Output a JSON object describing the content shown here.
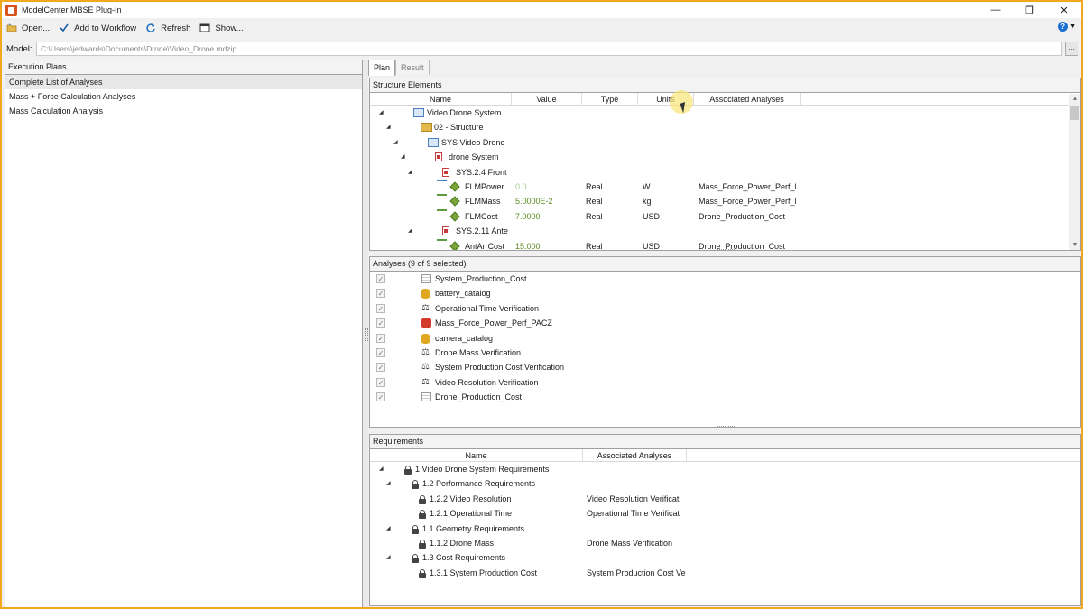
{
  "window": {
    "title": "ModelCenter MBSE Plug-In",
    "controls": [
      "—",
      "❐",
      "✕"
    ]
  },
  "toolbar": {
    "open": "Open...",
    "add_to_workflow": "Add to Workflow",
    "refresh": "Refresh",
    "show": "Show...",
    "help": "?"
  },
  "model": {
    "label": "Model:",
    "path": "C:\\Users\\jedwards\\Documents\\Drone\\Video_Drone.mdzip",
    "browse": "..."
  },
  "execution_plans": {
    "header": "Execution Plans",
    "items": [
      {
        "label": "Complete List of Analyses",
        "selected": true
      },
      {
        "label": "Mass + Force Calculation Analyses",
        "selected": false
      },
      {
        "label": "Mass Calculation Analysis",
        "selected": false
      }
    ]
  },
  "tabs": [
    {
      "label": "Plan",
      "active": true
    },
    {
      "label": "Result",
      "active": false
    }
  ],
  "structure": {
    "header": "Structure Elements",
    "columns": [
      "Name",
      "Value",
      "Type",
      "Units",
      "Associated Analyses"
    ],
    "rows": [
      {
        "level": 0,
        "icon": "system-block-icon",
        "expand": "◢",
        "name": "Video Drone System",
        "value": "",
        "type": "",
        "units": "",
        "analyses": ""
      },
      {
        "level": 1,
        "icon": "package-icon",
        "expand": "◢",
        "name": "02 - Structure",
        "value": "",
        "type": "",
        "units": "",
        "analyses": ""
      },
      {
        "level": 2,
        "icon": "system-block-icon",
        "expand": "◢",
        "name": "SYS Video Drone",
        "value": "",
        "type": "",
        "units": "",
        "analyses": ""
      },
      {
        "level": 3,
        "icon": "part-block-icon",
        "expand": "◢",
        "name": "drone System",
        "value": "",
        "type": "",
        "units": "",
        "analyses": ""
      },
      {
        "level": 4,
        "icon": "part-block-icon",
        "expand": "◢",
        "name": "SYS.2.4 Front",
        "value": "",
        "type": "",
        "units": "",
        "analyses": ""
      },
      {
        "level": 5,
        "icon": "value-property-icon",
        "expand": "",
        "name": "FLMPower",
        "value": "0.0",
        "value_dim": true,
        "type": "Real",
        "units": "W",
        "analyses": "Mass_Force_Power_Perf_Pi"
      },
      {
        "level": 5,
        "icon": "value-property-icon",
        "expand": "",
        "name": "FLMMass",
        "value": "5.0000E-2",
        "value_dim": false,
        "type": "Real",
        "units": "kg",
        "analyses": "Mass_Force_Power_Perf_Pi"
      },
      {
        "level": 5,
        "icon": "value-property-icon",
        "expand": "",
        "name": "FLMCost",
        "value": "7.0000",
        "value_dim": false,
        "type": "Real",
        "units": "USD",
        "analyses": "Drone_Production_Cost"
      },
      {
        "level": 4,
        "icon": "part-block-icon",
        "expand": "◢",
        "name": "SYS.2.11 Ante",
        "value": "",
        "type": "",
        "units": "",
        "analyses": ""
      },
      {
        "level": 5,
        "icon": "value-property-icon",
        "expand": "",
        "name": "AntArrCost",
        "value": "15.000",
        "value_dim": false,
        "type": "Real",
        "units": "USD",
        "analyses": "Drone_Production_Cost"
      }
    ]
  },
  "analyses": {
    "header": "Analyses (9 of 9 selected)",
    "items": [
      {
        "label": "System_Production_Cost",
        "icon": "spreadsheet-icon",
        "checked": true
      },
      {
        "label": "battery_catalog",
        "icon": "database-icon",
        "checked": true
      },
      {
        "label": "Operational Time Verification",
        "icon": "scale-icon",
        "checked": true
      },
      {
        "label": "Mass_Force_Power_Perf_PACZ",
        "icon": "workflow-icon",
        "checked": true
      },
      {
        "label": "camera_catalog",
        "icon": "database-icon",
        "checked": true
      },
      {
        "label": "Drone Mass Verification",
        "icon": "scale-icon",
        "checked": true
      },
      {
        "label": "System Production Cost Verification",
        "icon": "scale-icon",
        "checked": true
      },
      {
        "label": "Video Resolution Verification",
        "icon": "scale-icon",
        "checked": true
      },
      {
        "label": "Drone_Production_Cost",
        "icon": "spreadsheet-icon",
        "checked": true
      }
    ]
  },
  "requirements": {
    "header": "Requirements",
    "columns": [
      "Name",
      "Associated Analyses"
    ],
    "rows": [
      {
        "level": 0,
        "expand": "◢",
        "name": "1 Video Drone System Requirements",
        "analyses": ""
      },
      {
        "level": 1,
        "expand": "◢",
        "name": "1.2 Performance Requirements",
        "analyses": ""
      },
      {
        "level": 2,
        "expand": "",
        "name": "1.2.2 Video Resolution",
        "analyses": "Video Resolution Verificati"
      },
      {
        "level": 2,
        "expand": "",
        "name": "1.2.1 Operational Time",
        "analyses": "Operational Time Verificat"
      },
      {
        "level": 1,
        "expand": "◢",
        "name": "1.1 Geometry Requirements",
        "analyses": ""
      },
      {
        "level": 2,
        "expand": "",
        "name": "1.1.2 Drone Mass",
        "analyses": "Drone Mass Verification"
      },
      {
        "level": 1,
        "expand": "◢",
        "name": "1.3 Cost Requirements",
        "analyses": ""
      },
      {
        "level": 2,
        "expand": "",
        "name": "1.3.1 System Production Cost",
        "analyses": "System Production Cost Ve"
      }
    ]
  },
  "colors": {
    "window_border": "#f0a820",
    "value_text": "#5a8a1e",
    "value_dim_text": "#a9c98a"
  }
}
